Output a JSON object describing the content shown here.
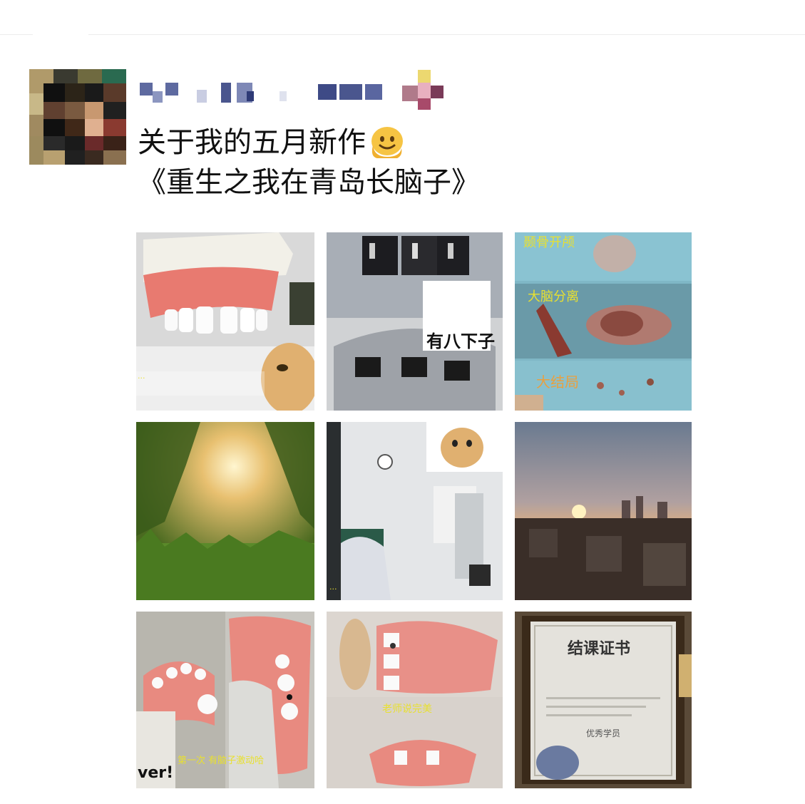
{
  "post": {
    "line1": "关于我的五月新作",
    "line2": "《重生之我在青岛长脑子》",
    "emoji_icon": "melting-face-emoji"
  },
  "images": {
    "tile2_sticker": "有八下子",
    "tile3_label1": "颞骨开颅",
    "tile3_label2": "大脑分离",
    "tile3_label3": "大结局",
    "tile7_caption": "第一次 有脑子激动哈",
    "tile7_sticker": "ver!",
    "tile8_caption": "老师说完美",
    "tile9_title": "结课证书",
    "tile9_stamp": "优秀学员"
  },
  "colors": {
    "text": "#111111",
    "caption_yellow": "#e8e030",
    "gum_pink": "#e87a70"
  }
}
